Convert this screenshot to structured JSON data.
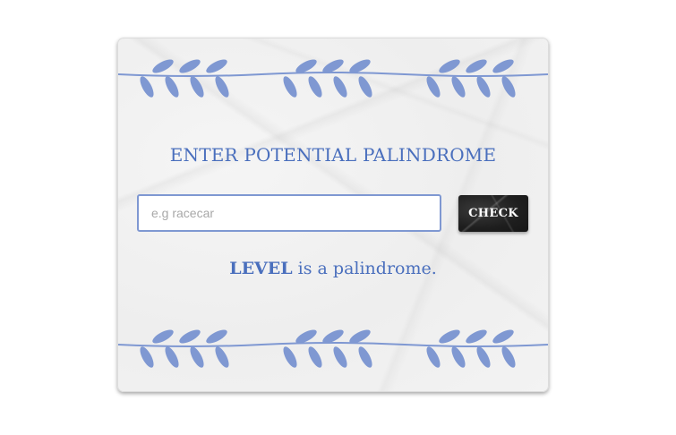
{
  "heading": "ENTER POTENTIAL PALINDROME",
  "input": {
    "placeholder": "e.g racecar",
    "value": ""
  },
  "check_button": "CHECK",
  "result": {
    "word": "LEVEL",
    "suffix": " is a palindrome."
  },
  "decorations": {
    "top_garland_icon": "laurel-branch-icon",
    "bottom_garland_icon": "laurel-branch-icon"
  },
  "colors": {
    "accent": "#4a6fbd",
    "leaf": "#7f98d2",
    "button": "#1e1e1e",
    "button_text": "#ffffff"
  }
}
